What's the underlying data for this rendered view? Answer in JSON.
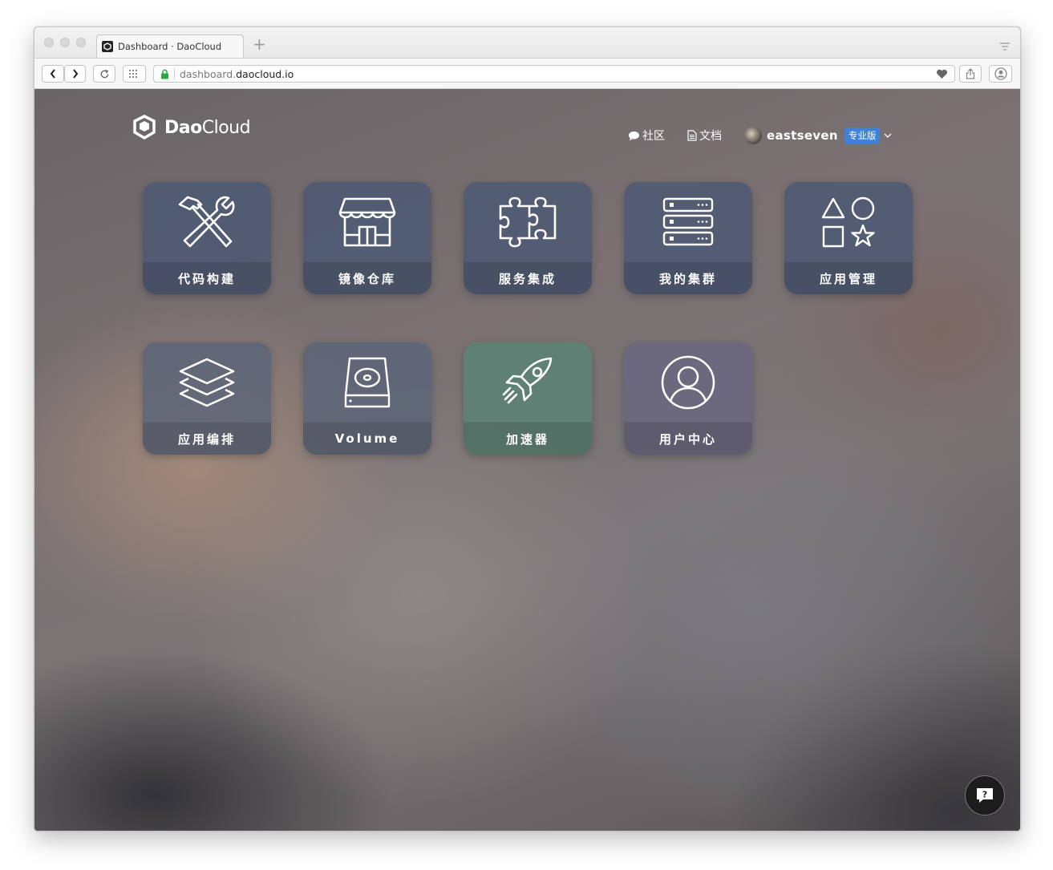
{
  "browser": {
    "tab_title": "Dashboard · DaoCloud",
    "url_prefix": "dashboard.",
    "url_domain": "daocloud.io"
  },
  "header": {
    "logo_bold": "Dao",
    "logo_light": "Cloud",
    "community_label": "社区",
    "docs_label": "文档",
    "username": "eastseven",
    "plan_badge": "专业版"
  },
  "tiles": [
    {
      "label": "代码构建",
      "icon": "tools-icon",
      "tint": "#4b5873"
    },
    {
      "label": "镜像仓库",
      "icon": "store-icon",
      "tint": "#4b5873"
    },
    {
      "label": "服务集成",
      "icon": "puzzle-icon",
      "tint": "#4b5873"
    },
    {
      "label": "我的集群",
      "icon": "server-icon",
      "tint": "#4b5873"
    },
    {
      "label": "应用管理",
      "icon": "shapes-icon",
      "tint": "#4b5873"
    },
    {
      "label": "应用编排",
      "icon": "layers-icon",
      "tint": "#5a6478"
    },
    {
      "label": "Volume",
      "icon": "disk-icon",
      "tint": "#5a6478"
    },
    {
      "label": "加速器",
      "icon": "rocket-icon",
      "tint": "#5b8275"
    },
    {
      "label": "用户中心",
      "icon": "user-icon",
      "tint": "#6a6680"
    }
  ],
  "help_button": {
    "icon": "help-chat-icon"
  }
}
